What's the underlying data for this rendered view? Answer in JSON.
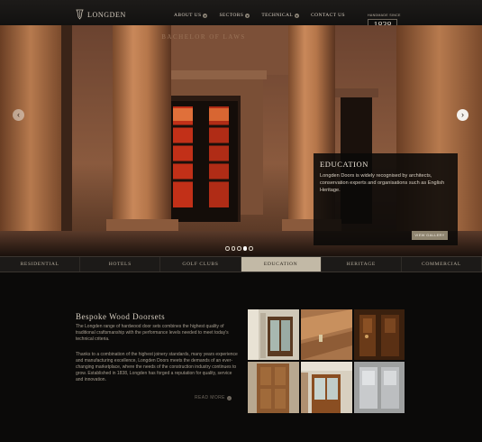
{
  "header": {
    "logo_text": "LONGDEN",
    "nav": [
      {
        "label": "ABOUT US",
        "has_dropdown": true
      },
      {
        "label": "SECTORS",
        "has_dropdown": true
      },
      {
        "label": "TECHNICAL",
        "has_dropdown": true
      },
      {
        "label": "CONTACT US",
        "has_dropdown": false
      }
    ],
    "badge_caption": "HANDMADE SINCE",
    "badge_year": "1838"
  },
  "hero": {
    "inscription": "BACHELOR OF LAWS",
    "caption_title": "EDUCATION",
    "caption_text": "Longden Doors is widely recognised by architects, conservation experts and organisations such as English Heritage.",
    "gallery_button": "VIEW GALLERY",
    "slide_count": 5,
    "active_slide": 4,
    "prev_icon": "chevron-left-icon",
    "next_icon": "chevron-right-icon"
  },
  "sector_tabs": [
    {
      "label": "RESIDENTIAL",
      "active": false
    },
    {
      "label": "HOTELS",
      "active": false
    },
    {
      "label": "GOLF CLUBS",
      "active": false
    },
    {
      "label": "EDUCATION",
      "active": true
    },
    {
      "label": "HERITAGE",
      "active": false
    },
    {
      "label": "COMMERCIAL",
      "active": false
    }
  ],
  "content": {
    "title": "Bespoke Wood Doorsets",
    "paragraph1": "The Longden range of hardwood door sets combines the highest quality of traditional craftsmanship with the performance levels needed to meet today's technical criteria.",
    "paragraph2": "Thanks to a combination of the highest joinery standards, many years experience and manufacturing excellence, Longden Doors meets the demands of an ever-changing marketplace, where the needs of the construction industry continues to grow. Established in 1838, Longden has forged a reputation for quality, service and innovation.",
    "read_more": "READ MORE"
  },
  "thumbnails": [
    {
      "name": "thumb-glazed-hall-doors"
    },
    {
      "name": "thumb-door-detail"
    },
    {
      "name": "thumb-panelled-room"
    },
    {
      "name": "thumb-wood-door"
    },
    {
      "name": "thumb-corridor-doors"
    },
    {
      "name": "thumb-white-panels"
    }
  ],
  "colors": {
    "background": "#0b0a09",
    "accent": "#c2b9a6",
    "gallery_button": "#8e846f"
  }
}
